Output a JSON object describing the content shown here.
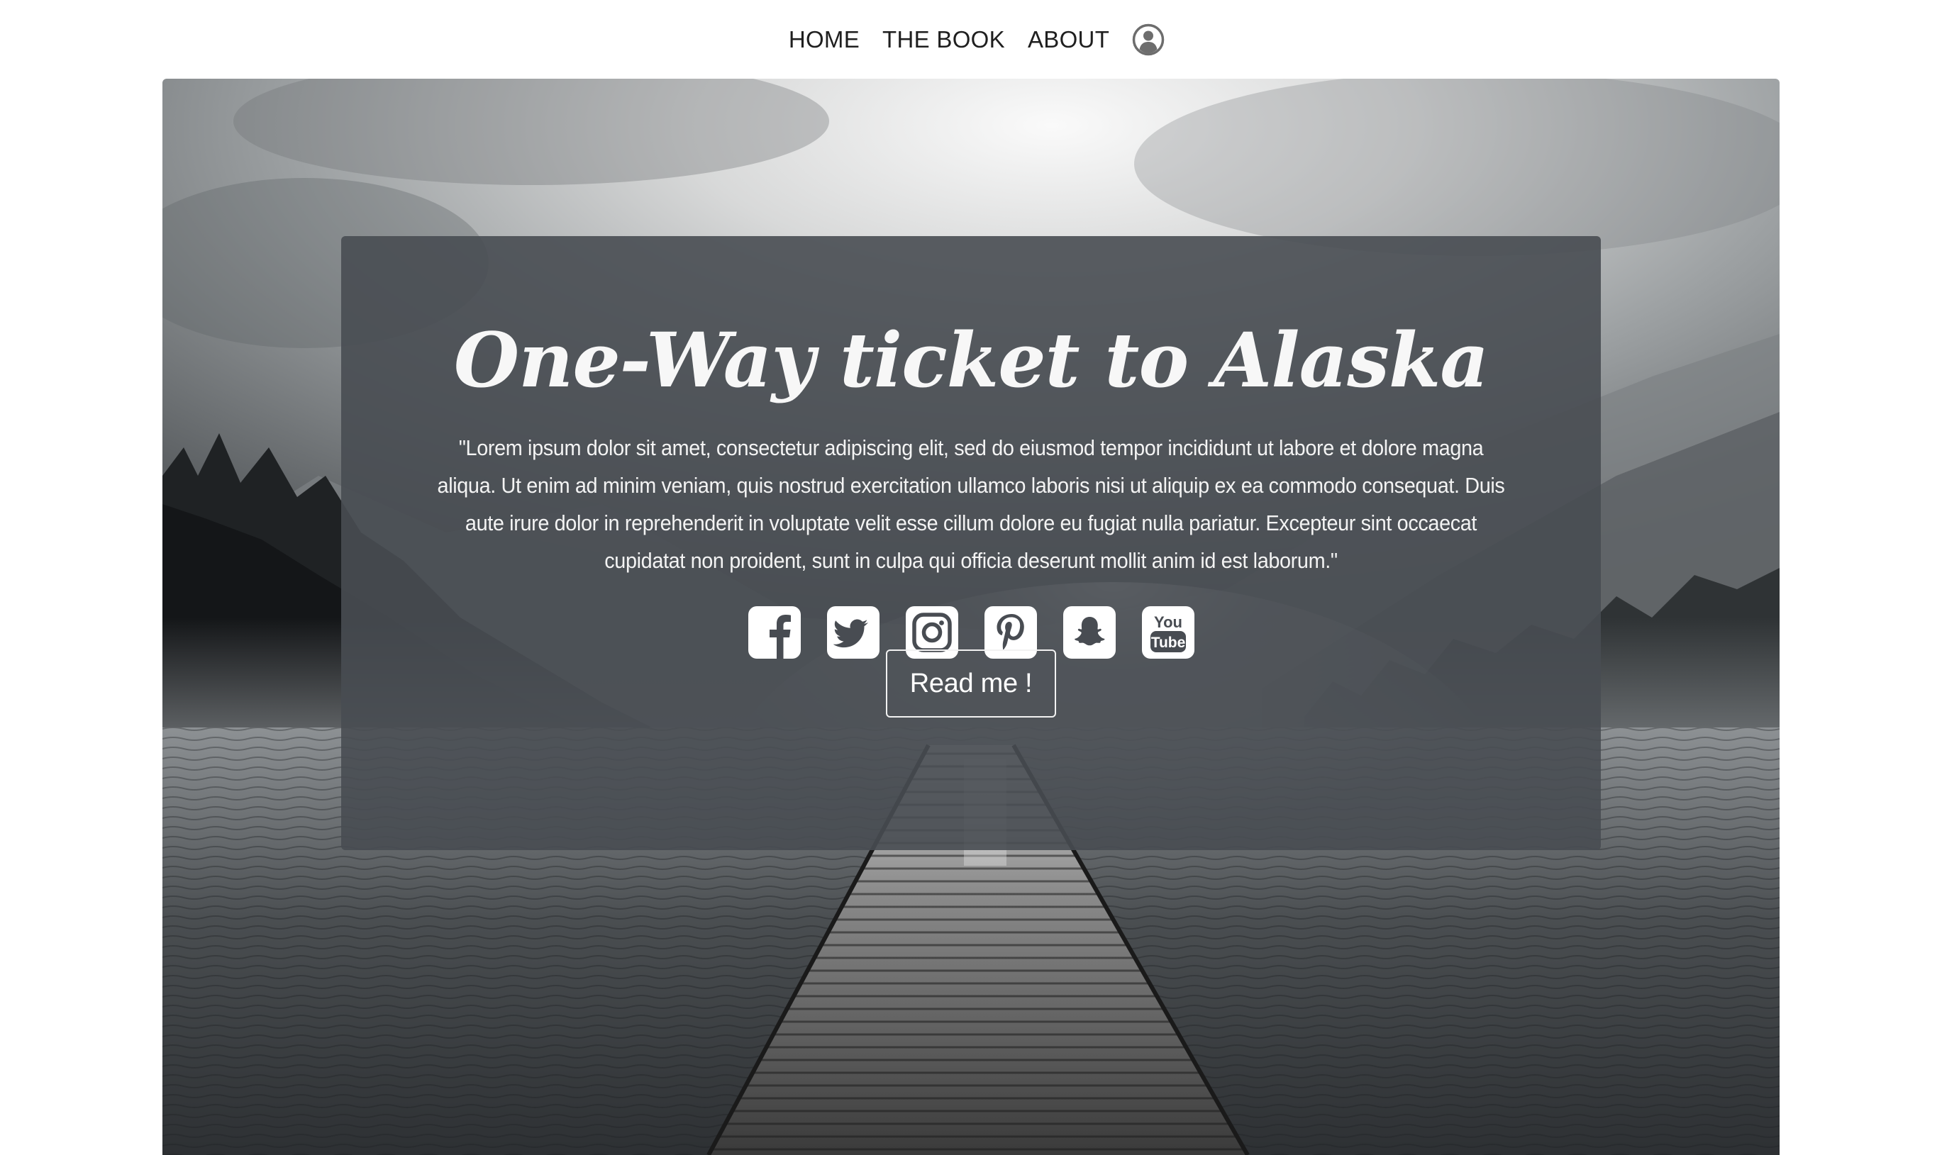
{
  "nav": {
    "items": [
      {
        "label": "HOME"
      },
      {
        "label": "THE BOOK"
      },
      {
        "label": "ABOUT"
      }
    ],
    "account_icon": "user-circle-icon"
  },
  "hero": {
    "title": "One-Way ticket to Alaska",
    "quote": "\"Lorem ipsum dolor sit amet, consectetur adipiscing elit, sed do eiusmod tempor incididunt ut labore et dolore magna aliqua. Ut enim ad minim veniam, quis nostrud exercitation ullamco laboris nisi ut aliquip ex ea commodo consequat. Duis aute irure dolor in reprehenderit in voluptate velit esse cillum dolore eu fugiat nulla pariatur. Excepteur sint occaecat cupidatat non proident, sunt in culpa qui officia deserunt mollit anim id est laborum.\"",
    "social_icons": [
      {
        "name": "facebook-icon"
      },
      {
        "name": "twitter-icon"
      },
      {
        "name": "instagram-icon"
      },
      {
        "name": "pinterest-icon"
      },
      {
        "name": "snapchat-icon"
      },
      {
        "name": "youtube-icon",
        "text_top": "You",
        "text_bottom": "Tube"
      }
    ],
    "button_label": "Read me !",
    "background_image": "grayscale-lake-pier-photo"
  },
  "colors": {
    "nav_text": "#1f1f1f",
    "overlay": "#484c52",
    "hero_text": "#f7f7f7",
    "icon_tile": "#ffffff"
  }
}
